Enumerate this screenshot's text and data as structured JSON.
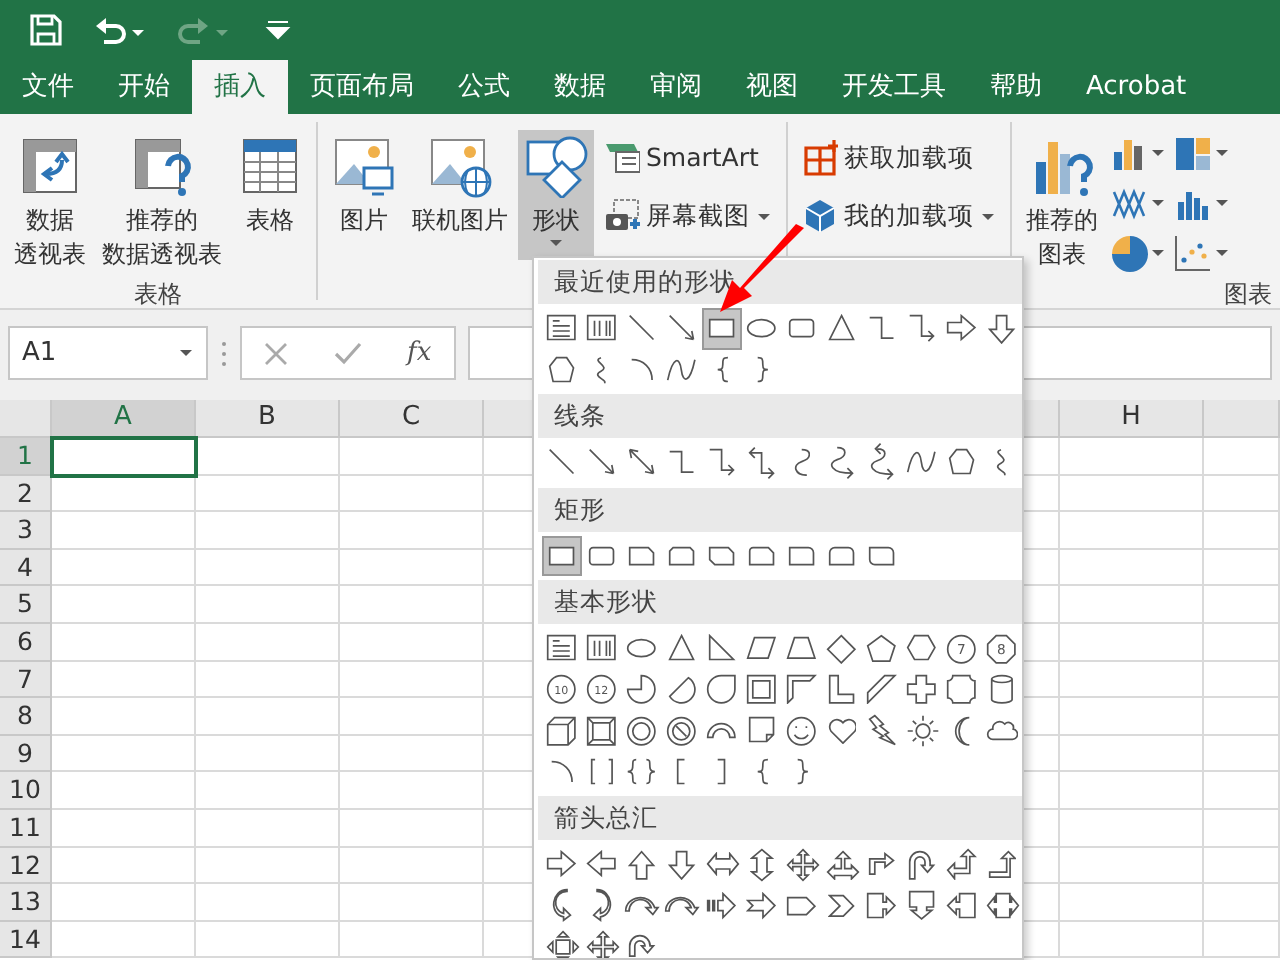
{
  "quick_access": [
    {
      "kind": "save",
      "disabled": false
    },
    {
      "kind": "undo",
      "disabled": false
    },
    {
      "kind": "redo",
      "disabled": true
    },
    {
      "kind": "customize",
      "disabled": false
    }
  ],
  "tabs": [
    {
      "label": "文件",
      "selected": false
    },
    {
      "label": "开始",
      "selected": false
    },
    {
      "label": "插入",
      "selected": true
    },
    {
      "label": "页面布局",
      "selected": false
    },
    {
      "label": "公式",
      "selected": false
    },
    {
      "label": "数据",
      "selected": false
    },
    {
      "label": "审阅",
      "selected": false
    },
    {
      "label": "视图",
      "selected": false
    },
    {
      "label": "开发工具",
      "selected": false
    },
    {
      "label": "帮助",
      "selected": false
    },
    {
      "label": "Acrobat",
      "selected": false
    }
  ],
  "ribbon_groups": [
    {
      "label": "表格",
      "large": [
        {
          "kind": "pivot",
          "lines": [
            "数据",
            "透视表"
          ],
          "pressed": false,
          "dropdown": false
        },
        {
          "kind": "recommended-pivot",
          "lines": [
            "推荐的",
            "数据透视表"
          ],
          "pressed": false,
          "dropdown": false
        },
        {
          "kind": "table",
          "lines": [
            "表格"
          ],
          "pressed": false,
          "dropdown": false
        }
      ]
    },
    {
      "large": [
        {
          "kind": "picture",
          "lines": [
            "图片"
          ],
          "pressed": false,
          "dropdown": false
        },
        {
          "kind": "online-picture",
          "lines": [
            "联机图片"
          ],
          "pressed": false,
          "dropdown": false
        },
        {
          "kind": "shapes",
          "lines": [
            "形状"
          ],
          "pressed": true,
          "dropdown": true
        }
      ],
      "small": [
        {
          "kind": "smartart",
          "label": "SmartArt",
          "dropdown": false
        },
        {
          "kind": "screenshot",
          "label": "屏幕截图",
          "dropdown": true
        }
      ]
    },
    {
      "small": [
        {
          "kind": "get-addins",
          "label": "获取加载项",
          "dropdown": false
        },
        {
          "kind": "my-addins",
          "label": "我的加载项",
          "dropdown": true
        }
      ]
    },
    {
      "label": "图表",
      "large": [
        {
          "kind": "recommended-chart",
          "lines": [
            "推荐的",
            "图表"
          ],
          "pressed": false,
          "dropdown": false
        }
      ],
      "chart_buttons": [
        {
          "kind": "column"
        },
        {
          "kind": "hierarchy"
        },
        {
          "kind": "line"
        },
        {
          "kind": "bar"
        },
        {
          "kind": "pie"
        },
        {
          "kind": "scatter"
        }
      ]
    }
  ],
  "formula_bar": {
    "name_box": "A1",
    "function_label": "fx"
  },
  "sheet": {
    "columns": [
      {
        "label": "A",
        "selected": true
      },
      {
        "label": "B",
        "selected": false
      },
      {
        "label": "C",
        "selected": false
      },
      {
        "label": "H",
        "selected": false
      }
    ],
    "rows": [
      {
        "label": "1",
        "selected": true
      },
      {
        "label": "2",
        "selected": false
      },
      {
        "label": "3",
        "selected": false
      },
      {
        "label": "4",
        "selected": false
      },
      {
        "label": "5",
        "selected": false
      },
      {
        "label": "6",
        "selected": false
      },
      {
        "label": "7",
        "selected": false
      },
      {
        "label": "8",
        "selected": false
      },
      {
        "label": "9",
        "selected": false
      },
      {
        "label": "10",
        "selected": false
      },
      {
        "label": "11",
        "selected": false
      },
      {
        "label": "12",
        "selected": false
      },
      {
        "label": "13",
        "selected": false
      },
      {
        "label": "14",
        "selected": false
      }
    ]
  },
  "shapes_gallery": [
    {
      "title": "最近使用的形状",
      "shapes": [
        {
          "kind": "textbox",
          "selected": false
        },
        {
          "kind": "vertical-textbox",
          "selected": false
        },
        {
          "kind": "line",
          "selected": false
        },
        {
          "kind": "arrow-line",
          "selected": false
        },
        {
          "kind": "rectangle",
          "selected": true
        },
        {
          "kind": "oval",
          "selected": false
        },
        {
          "kind": "rounded-rectangle",
          "selected": false
        },
        {
          "kind": "triangle",
          "selected": false
        },
        {
          "kind": "elbow",
          "selected": false
        },
        {
          "kind": "elbow-arrow",
          "selected": false
        },
        {
          "kind": "right-arrow",
          "selected": false
        },
        {
          "kind": "down-arrow",
          "selected": false
        },
        {
          "kind": "freeform",
          "selected": false
        },
        {
          "kind": "scribble",
          "selected": false
        },
        {
          "kind": "arc",
          "selected": false
        },
        {
          "kind": "curve",
          "selected": false
        },
        {
          "kind": "left-brace",
          "selected": false
        },
        {
          "kind": "right-brace",
          "selected": false
        }
      ]
    },
    {
      "title": "线条",
      "shapes": [
        {
          "kind": "line",
          "selected": false
        },
        {
          "kind": "arrow-line",
          "selected": false
        },
        {
          "kind": "double-arrow-line",
          "selected": false
        },
        {
          "kind": "elbow",
          "selected": false
        },
        {
          "kind": "elbow-arrow",
          "selected": false
        },
        {
          "kind": "elbow-double-arrow",
          "selected": false
        },
        {
          "kind": "curved-connector",
          "selected": false
        },
        {
          "kind": "curved-arrow-connector",
          "selected": false
        },
        {
          "kind": "curved-double-arrow-connector",
          "selected": false
        },
        {
          "kind": "curve",
          "selected": false
        },
        {
          "kind": "freeform",
          "selected": false
        },
        {
          "kind": "scribble",
          "selected": false
        }
      ]
    },
    {
      "title": "矩形",
      "shapes": [
        {
          "kind": "rectangle",
          "selected": true
        },
        {
          "kind": "rounded-rectangle",
          "selected": false
        },
        {
          "kind": "snip-corner-rectangle",
          "selected": false
        },
        {
          "kind": "snip-same-rectangle",
          "selected": false
        },
        {
          "kind": "snip-diagonal-rectangle",
          "selected": false
        },
        {
          "kind": "snip-round-rectangle",
          "selected": false
        },
        {
          "kind": "round-corner-rectangle",
          "selected": false
        },
        {
          "kind": "round-same-rectangle",
          "selected": false
        },
        {
          "kind": "round-diagonal-rectangle",
          "selected": false
        }
      ]
    },
    {
      "title": "基本形状",
      "shapes": [
        {
          "kind": "textbox",
          "selected": false
        },
        {
          "kind": "vertical-textbox",
          "selected": false
        },
        {
          "kind": "oval",
          "selected": false
        },
        {
          "kind": "triangle",
          "selected": false
        },
        {
          "kind": "right-triangle",
          "selected": false
        },
        {
          "kind": "parallelogram",
          "selected": false
        },
        {
          "kind": "trapezoid",
          "selected": false
        },
        {
          "kind": "diamond",
          "selected": false
        },
        {
          "kind": "pentagon",
          "selected": false
        },
        {
          "kind": "hexagon",
          "selected": false
        },
        {
          "kind": "heptagon",
          "label": "7",
          "selected": false
        },
        {
          "kind": "octagon",
          "label": "8",
          "selected": false
        },
        {
          "kind": "decagon",
          "label": "10",
          "selected": false
        },
        {
          "kind": "dodecagon",
          "label": "12",
          "selected": false
        },
        {
          "kind": "pie",
          "selected": false
        },
        {
          "kind": "chord",
          "selected": false
        },
        {
          "kind": "teardrop",
          "selected": false
        },
        {
          "kind": "frame",
          "selected": false
        },
        {
          "kind": "half-frame",
          "selected": false
        },
        {
          "kind": "l-shape",
          "selected": false
        },
        {
          "kind": "diagonal-stripe",
          "selected": false
        },
        {
          "kind": "cross",
          "selected": false
        },
        {
          "kind": "plaque",
          "selected": false
        },
        {
          "kind": "can",
          "selected": false
        },
        {
          "kind": "cube",
          "selected": false
        },
        {
          "kind": "bevel",
          "selected": false
        },
        {
          "kind": "donut",
          "selected": false
        },
        {
          "kind": "no-symbol",
          "selected": false
        },
        {
          "kind": "block-arc",
          "selected": false
        },
        {
          "kind": "folded-corner",
          "selected": false
        },
        {
          "kind": "smiley",
          "selected": false
        },
        {
          "kind": "heart",
          "selected": false
        },
        {
          "kind": "lightning",
          "selected": false
        },
        {
          "kind": "sun",
          "selected": false
        },
        {
          "kind": "moon",
          "selected": false
        },
        {
          "kind": "cloud",
          "selected": false
        },
        {
          "kind": "arc",
          "selected": false
        },
        {
          "kind": "bracket-pair",
          "selected": false
        },
        {
          "kind": "brace-pair",
          "selected": false
        },
        {
          "kind": "left-bracket",
          "selected": false
        },
        {
          "kind": "right-bracket",
          "selected": false
        },
        {
          "kind": "left-brace",
          "selected": false
        },
        {
          "kind": "right-brace",
          "selected": false
        }
      ]
    },
    {
      "title": "箭头总汇",
      "shapes": [
        {
          "kind": "right-arrow",
          "selected": false
        },
        {
          "kind": "left-arrow",
          "selected": false
        },
        {
          "kind": "up-arrow",
          "selected": false
        },
        {
          "kind": "down-arrow",
          "selected": false
        },
        {
          "kind": "left-right-arrow",
          "selected": false
        },
        {
          "kind": "up-down-arrow",
          "selected": false
        },
        {
          "kind": "quad-arrow",
          "selected": false
        },
        {
          "kind": "left-right-up-arrow",
          "selected": false
        },
        {
          "kind": "bent-arrow",
          "selected": false
        },
        {
          "kind": "u-turn-arrow",
          "selected": false
        },
        {
          "kind": "left-up-arrow",
          "selected": false
        },
        {
          "kind": "bent-up-arrow",
          "selected": false
        },
        {
          "kind": "curved-right-arrow",
          "selected": false
        },
        {
          "kind": "curved-left-arrow",
          "selected": false
        },
        {
          "kind": "curved-up-arrow",
          "selected": false
        },
        {
          "kind": "curved-down-arrow",
          "selected": false
        },
        {
          "kind": "striped-right-arrow",
          "selected": false
        },
        {
          "kind": "notched-right-arrow",
          "selected": false
        },
        {
          "kind": "pentagon-arrow",
          "selected": false
        },
        {
          "kind": "chevron",
          "selected": false
        },
        {
          "kind": "right-arrow-callout",
          "selected": false
        },
        {
          "kind": "down-arrow-callout",
          "selected": false
        },
        {
          "kind": "left-arrow-callout",
          "selected": false
        },
        {
          "kind": "left-right-arrow-callout",
          "selected": false
        },
        {
          "kind": "quad-arrow-callout",
          "selected": false
        },
        {
          "kind": "quad-arrow",
          "selected": false
        },
        {
          "kind": "circular-arrow",
          "selected": false
        }
      ]
    }
  ]
}
